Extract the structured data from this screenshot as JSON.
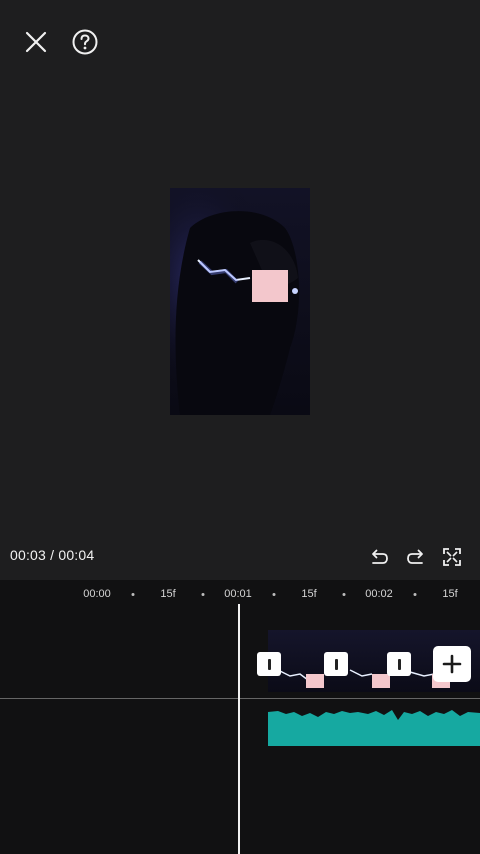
{
  "header": {
    "close_icon": "close-icon",
    "help_icon": "help-icon"
  },
  "playback": {
    "current_time": "00:03",
    "separator": " / ",
    "total_time": "00:04",
    "undo_icon": "undo-icon",
    "redo_icon": "redo-icon",
    "fullscreen_icon": "fullscreen-icon"
  },
  "timeline": {
    "ruler_labels": [
      "00:00",
      "15f",
      "00:01",
      "15f",
      "00:02",
      "15f"
    ],
    "add_clip_icon": "plus-icon",
    "transition_icon": "transition-icon"
  },
  "colors": {
    "background": "#1e1e1f",
    "timeline_bg": "#111112",
    "audio_wave": "#16a9a1",
    "accent_white": "#ffffff"
  }
}
